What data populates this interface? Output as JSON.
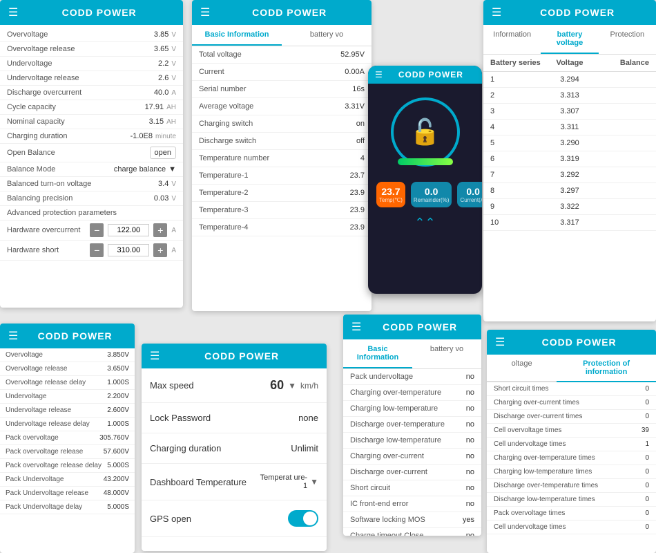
{
  "app": {
    "name": "CODD POWER"
  },
  "panel1": {
    "title": "CODD POWER",
    "rows": [
      {
        "label": "Overvoltage",
        "value": "3.85",
        "unit": "V"
      },
      {
        "label": "Overvoltage release",
        "value": "3.65",
        "unit": "V"
      },
      {
        "label": "Undervoltage",
        "value": "2.2",
        "unit": "V"
      },
      {
        "label": "Undervoltage release",
        "value": "2.6",
        "unit": "V"
      },
      {
        "label": "Discharge overcurrent",
        "value": "40.0",
        "unit": "A"
      },
      {
        "label": "Cycle capacity",
        "value": "17.91",
        "unit": "AH"
      },
      {
        "label": "Nominal capacity",
        "value": "3.15",
        "unit": "AH"
      },
      {
        "label": "Charging duration",
        "value": "-1.0E8",
        "unit": "minute"
      }
    ],
    "open_balance_label": "Open Balance",
    "open_balance_value": "open",
    "balance_mode_label": "Balance Mode",
    "balance_mode_value": "charge balance",
    "balanced_turnon_label": "Balanced turn-on voltage",
    "balanced_turnon_value": "3.4",
    "balanced_turnon_unit": "V",
    "balancing_precision_label": "Balancing precision",
    "balancing_precision_value": "0.03",
    "balancing_precision_unit": "V",
    "advanced_label": "Advanced protection parameters",
    "hw_overcurrent_label": "Hardware overcurrent",
    "hw_overcurrent_value": "122.00",
    "hw_overcurrent_unit": "A",
    "hw_short_label": "Hardware short",
    "hw_short_value": "310.00",
    "hw_short_unit": "A"
  },
  "panel2": {
    "title": "CODD POWER",
    "tab1": "Basic Information",
    "tab2": "battery vo",
    "rows": [
      {
        "label": "Total voltage",
        "value": "52.95V"
      },
      {
        "label": "Current",
        "value": "0.00A"
      },
      {
        "label": "Serial number",
        "value": "16s"
      },
      {
        "label": "Average voltage",
        "value": "3.31V"
      },
      {
        "label": "Charging switch",
        "value": "on"
      },
      {
        "label": "Discharge switch",
        "value": "off"
      },
      {
        "label": "Temperature number",
        "value": "4"
      },
      {
        "label": "Temperature-1",
        "value": "23.7"
      },
      {
        "label": "Temperature-2",
        "value": "23.9"
      },
      {
        "label": "Temperature-3",
        "value": "23.9"
      },
      {
        "label": "Temperature-4",
        "value": "23.9"
      }
    ]
  },
  "panel3": {
    "title": "CODD POWER",
    "temp": "23.7",
    "temp_label": "Temp(℃)",
    "remainder": "0.0",
    "remainder_label": "Remainder(%)",
    "current": "0.0",
    "current_label": "Current(A)"
  },
  "panel4": {
    "title": "CODD POWER",
    "tab1": "Information",
    "tab2": "battery voltage",
    "tab3": "Protection",
    "col1": "Battery series",
    "col2": "Voltage",
    "col3": "Balance",
    "rows": [
      {
        "series": "1",
        "voltage": "3.294",
        "balance": ""
      },
      {
        "series": "2",
        "voltage": "3.313",
        "balance": ""
      },
      {
        "series": "3",
        "voltage": "3.307",
        "balance": ""
      },
      {
        "series": "4",
        "voltage": "3.311",
        "balance": ""
      },
      {
        "series": "5",
        "voltage": "3.290",
        "balance": ""
      },
      {
        "series": "6",
        "voltage": "3.319",
        "balance": ""
      },
      {
        "series": "7",
        "voltage": "3.292",
        "balance": ""
      },
      {
        "series": "8",
        "voltage": "3.297",
        "balance": ""
      },
      {
        "series": "9",
        "voltage": "3.322",
        "balance": ""
      },
      {
        "series": "10",
        "voltage": "3.317",
        "balance": ""
      }
    ]
  },
  "panel5": {
    "title": "CODD POWER",
    "rows": [
      {
        "label": "Overvoltage",
        "value": "3.850V"
      },
      {
        "label": "Overvoltage release",
        "value": "3.650V"
      },
      {
        "label": "Overvoltage release delay",
        "value": "1.000S"
      },
      {
        "label": "Undervoltage",
        "value": "2.200V"
      },
      {
        "label": "Undervoltage release",
        "value": "2.600V"
      },
      {
        "label": "Undervoltage release delay",
        "value": "1.000S"
      },
      {
        "label": "Pack overvoltage",
        "value": "305.760V"
      },
      {
        "label": "Pack overvoltage release",
        "value": "57.600V"
      },
      {
        "label": "Pack overvoltage release delay",
        "value": "5.000S"
      },
      {
        "label": "Pack Undervoltage",
        "value": "43.200V"
      },
      {
        "label": "Pack Undervoltage release",
        "value": "48.000V"
      },
      {
        "label": "Pack Undervoltage delay",
        "value": "5.000S"
      }
    ]
  },
  "panel6": {
    "title": "CODD POWER",
    "max_speed_label": "Max speed",
    "max_speed_value": "60",
    "max_speed_unit": "km/h",
    "lock_password_label": "Lock Password",
    "lock_password_value": "none",
    "charging_duration_label": "Charging duration",
    "charging_duration_value": "Unlimit",
    "dashboard_temp_label": "Dashboard Temperature",
    "dashboard_temp_value": "Temperat ure-1",
    "gps_open_label": "GPS open"
  },
  "panel7": {
    "title": "CODD POWER",
    "tab1": "Basic Information",
    "tab2": "battery vo",
    "rows": [
      {
        "label": "Pack undervoltage",
        "value": "no"
      },
      {
        "label": "Charging over-temperature",
        "value": "no"
      },
      {
        "label": "Charging low-temperature",
        "value": "no"
      },
      {
        "label": "Discharge over-temperature",
        "value": "no"
      },
      {
        "label": "Discharge low-temperature",
        "value": "no"
      },
      {
        "label": "Charging over-current",
        "value": "no"
      },
      {
        "label": "Discharge over-current",
        "value": "no"
      },
      {
        "label": "Short circuit",
        "value": "no"
      },
      {
        "label": "IC front-end error",
        "value": "no"
      },
      {
        "label": "Software locking MOS",
        "value": "yes"
      },
      {
        "label": "Charge timeout Close",
        "value": "no"
      }
    ]
  },
  "panel8": {
    "title": "CODD POWER",
    "tab1": "oltage",
    "tab2": "Protection of information",
    "rows": [
      {
        "label": "Short circuit times",
        "value": "0"
      },
      {
        "label": "Charging over-current times",
        "value": "0"
      },
      {
        "label": "Discharge over-current times",
        "value": "0"
      },
      {
        "label": "Cell overvoltage times",
        "value": "39"
      },
      {
        "label": "Cell undervoltage times",
        "value": "1"
      },
      {
        "label": "Charging over-temperature times",
        "value": "0"
      },
      {
        "label": "Charging low-temperature times",
        "value": "0"
      },
      {
        "label": "Discharge over-temperature times",
        "value": "0"
      },
      {
        "label": "Discharge low-temperature times",
        "value": "0"
      },
      {
        "label": "Pack overvoltage times",
        "value": "0"
      },
      {
        "label": "Cell undervoltage times",
        "value": "0"
      }
    ]
  }
}
